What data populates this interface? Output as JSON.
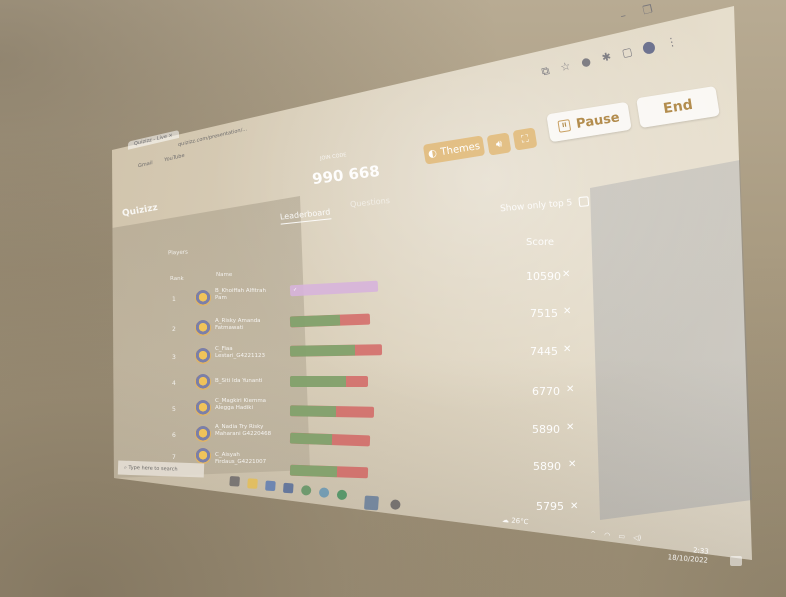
{
  "browser": {
    "tab_title": "Quizizz - Live",
    "url": "quizizz.com/presentation/...",
    "bookmarks": [
      "Gmail",
      "YouTube"
    ]
  },
  "header": {
    "pin_label": "JOIN CODE",
    "join_code": "990 668",
    "logo": "Quizizz"
  },
  "controls": {
    "themes_label": "Themes",
    "sound_icon": "speaker-icon",
    "fullscreen_icon": "fullscreen-icon",
    "pause_label": "Pause",
    "end_label": "End"
  },
  "tabs": {
    "leaderboard": "Leaderboard",
    "questions": "Questions"
  },
  "leaderboard": {
    "players_label": "Players",
    "rank_header": "Rank",
    "name_header": "Name",
    "score_header": "Score",
    "show_top5_label": "Show only top 5",
    "rows": [
      {
        "rank": "1",
        "name": "B_Khoiffah Alfitrah Pam",
        "accuracy": 0.0,
        "score": "10590"
      },
      {
        "rank": "2",
        "name": "A_Risky Amanda Fatmawati",
        "accuracy": 0.62,
        "score": "7515"
      },
      {
        "rank": "3",
        "name": "C_Fiaa Lestari_G4221123",
        "accuracy": 0.71,
        "score": "7445"
      },
      {
        "rank": "4",
        "name": "B_Siti Ida Yunanti",
        "accuracy": 0.72,
        "score": "6770"
      },
      {
        "rank": "5",
        "name": "C_Magkiri Kiemma Alegga Hadiki",
        "accuracy": 0.55,
        "score": "5890"
      },
      {
        "rank": "6",
        "name": "A_Nadia Try Risky Maharani G4220468",
        "accuracy": 0.52,
        "score": "5890"
      },
      {
        "rank": "7",
        "name": "C_Aisyah Firdaus_G4221007",
        "accuracy": 0.6,
        "score": "5795"
      }
    ]
  },
  "taskbar": {
    "search_placeholder": "Type here to search",
    "weather": "26°C",
    "time": "2:33",
    "date": "18/10/2022"
  }
}
